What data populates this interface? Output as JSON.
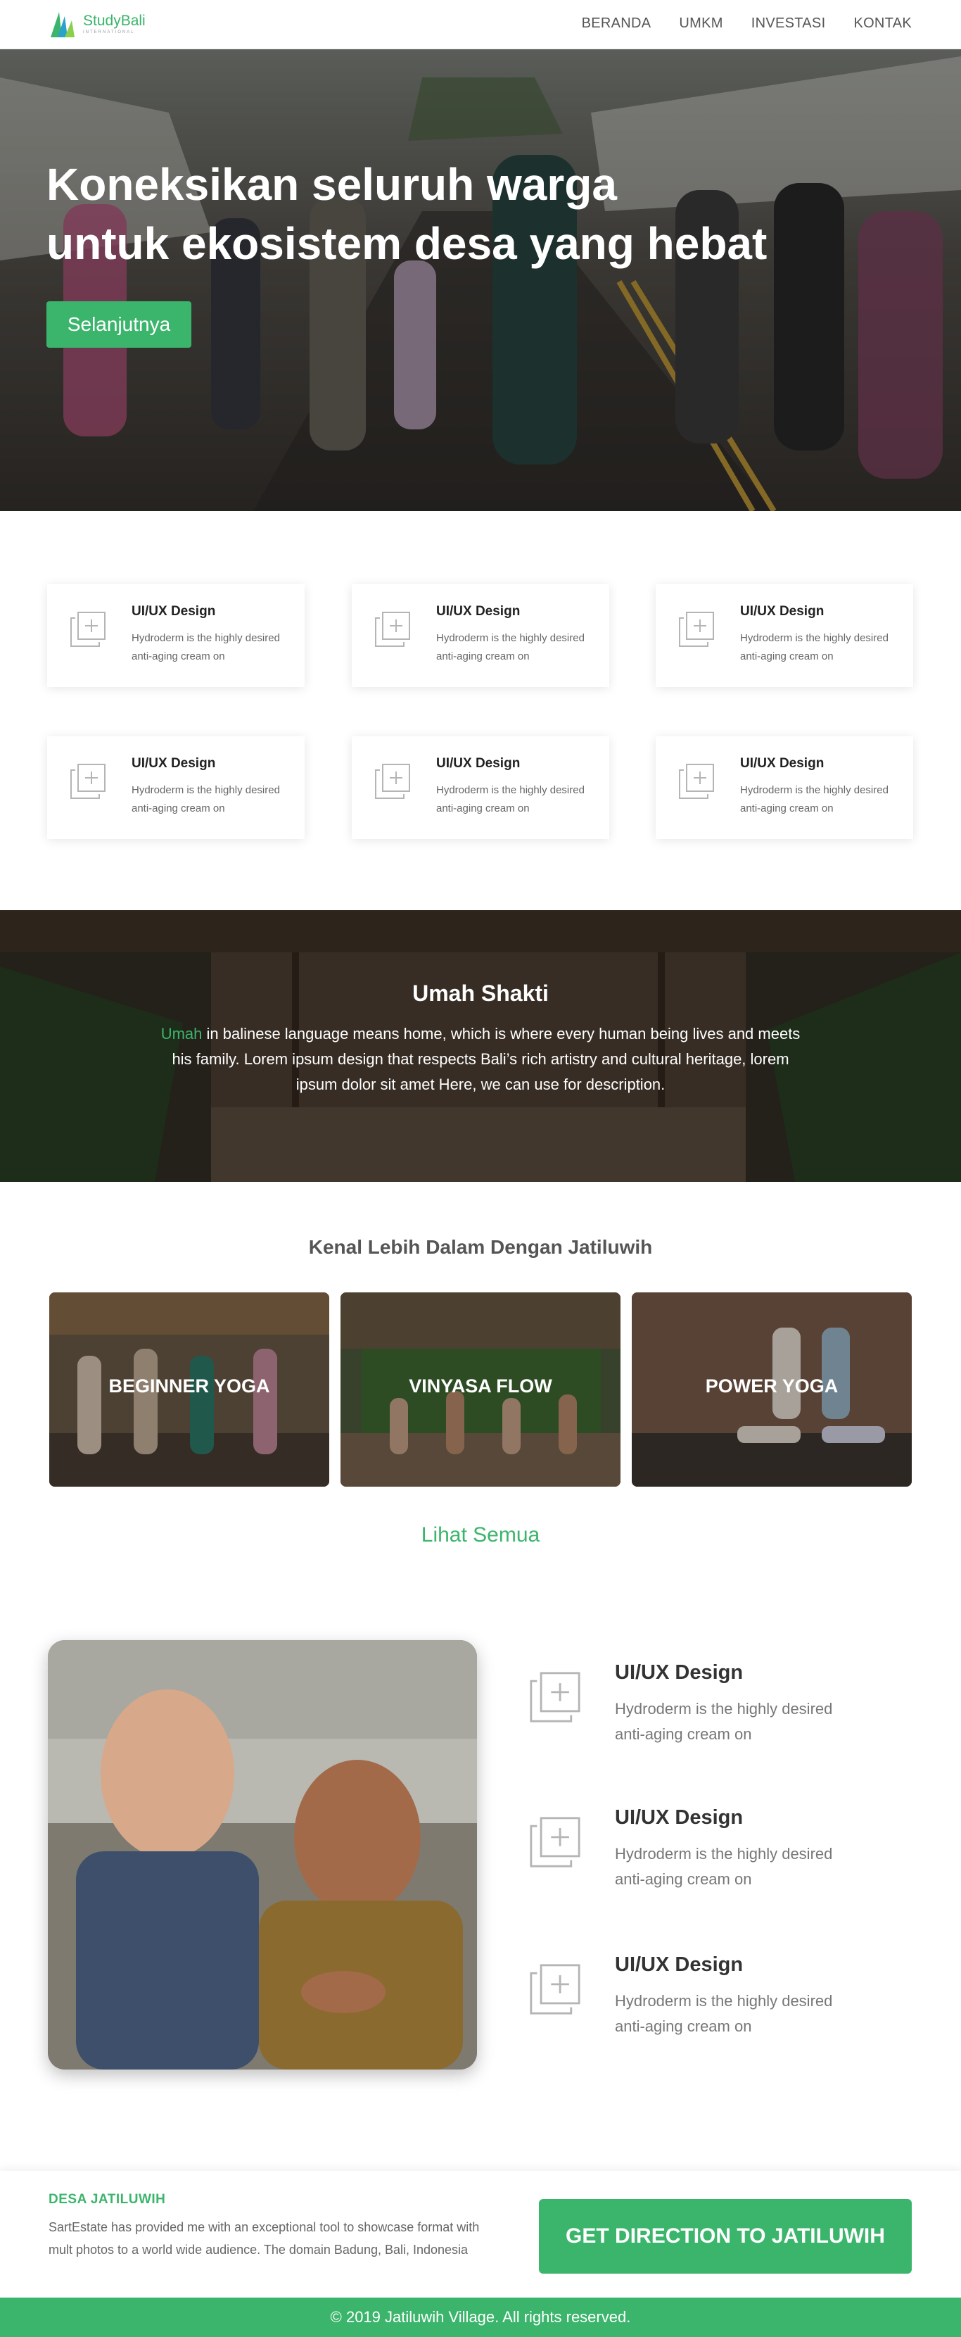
{
  "nav": {
    "brand": "StudyBali",
    "brand_sub": "INTERNATIONAL",
    "items": [
      "BERANDA",
      "UMKM",
      "INVESTASI",
      "KONTAK"
    ]
  },
  "hero": {
    "title_line1": "Koneksikan seluruh warga",
    "title_line2": "untuk ekosistem desa yang hebat",
    "button": "Selanjutnya"
  },
  "features": [
    {
      "title": "UI/UX Design",
      "desc": "Hydroderm is the highly desired anti-aging cream on",
      "icon": "add-image-icon"
    },
    {
      "title": "UI/UX Design",
      "desc": "Hydroderm is the highly desired anti-aging cream on",
      "icon": "add-image-icon"
    },
    {
      "title": "UI/UX Design",
      "desc": "Hydroderm is the highly desired anti-aging cream on",
      "icon": "add-image-icon"
    },
    {
      "title": "UI/UX Design",
      "desc": "Hydroderm is the highly desired anti-aging cream on",
      "icon": "add-image-icon"
    },
    {
      "title": "UI/UX Design",
      "desc": "Hydroderm is the highly desired anti-aging cream on",
      "icon": "add-image-icon"
    },
    {
      "title": "UI/UX Design",
      "desc": "Hydroderm is the highly desired anti-aging cream on",
      "icon": "add-image-icon"
    }
  ],
  "umah": {
    "title": "Umah Shakti",
    "highlight": "Umah",
    "text": " in balinese language means home, which is where every human being lives and meets his family. Lorem ipsum design that respects Bali’s rich artistry and cultural heritage, lorem ipsum dolor sit amet Here, we can use for description."
  },
  "kenal": {
    "title": "Kenal Lebih Dalam Dengan Jatiluwih",
    "tiles": [
      "BEGINNER YOGA",
      "VINYASA FLOW",
      "POWER YOGA"
    ],
    "see_all": "Lihat Semua"
  },
  "list": [
    {
      "title": "UI/UX Design",
      "desc": "Hydroderm is the highly desired anti-aging cream on"
    },
    {
      "title": "UI/UX Design",
      "desc": "Hydroderm is the highly desired anti-aging cream on"
    },
    {
      "title": "UI/UX Design",
      "desc": "Hydroderm is the highly desired anti-aging cream on"
    }
  ],
  "footer": {
    "title": "DESA JATILUWIH",
    "desc": "SartEstate has provided me with an exceptional tool to showcase format with mult photos to a world wide audience. The domain Badung, Bali, Indonesia",
    "button": "GET DIRECTION TO JATILUWIH",
    "copyright": "© 2019 Jatiluwih Village. All rights reserved."
  },
  "colors": {
    "accent": "#3cb56c",
    "text": "#333333",
    "muted": "#666666"
  }
}
